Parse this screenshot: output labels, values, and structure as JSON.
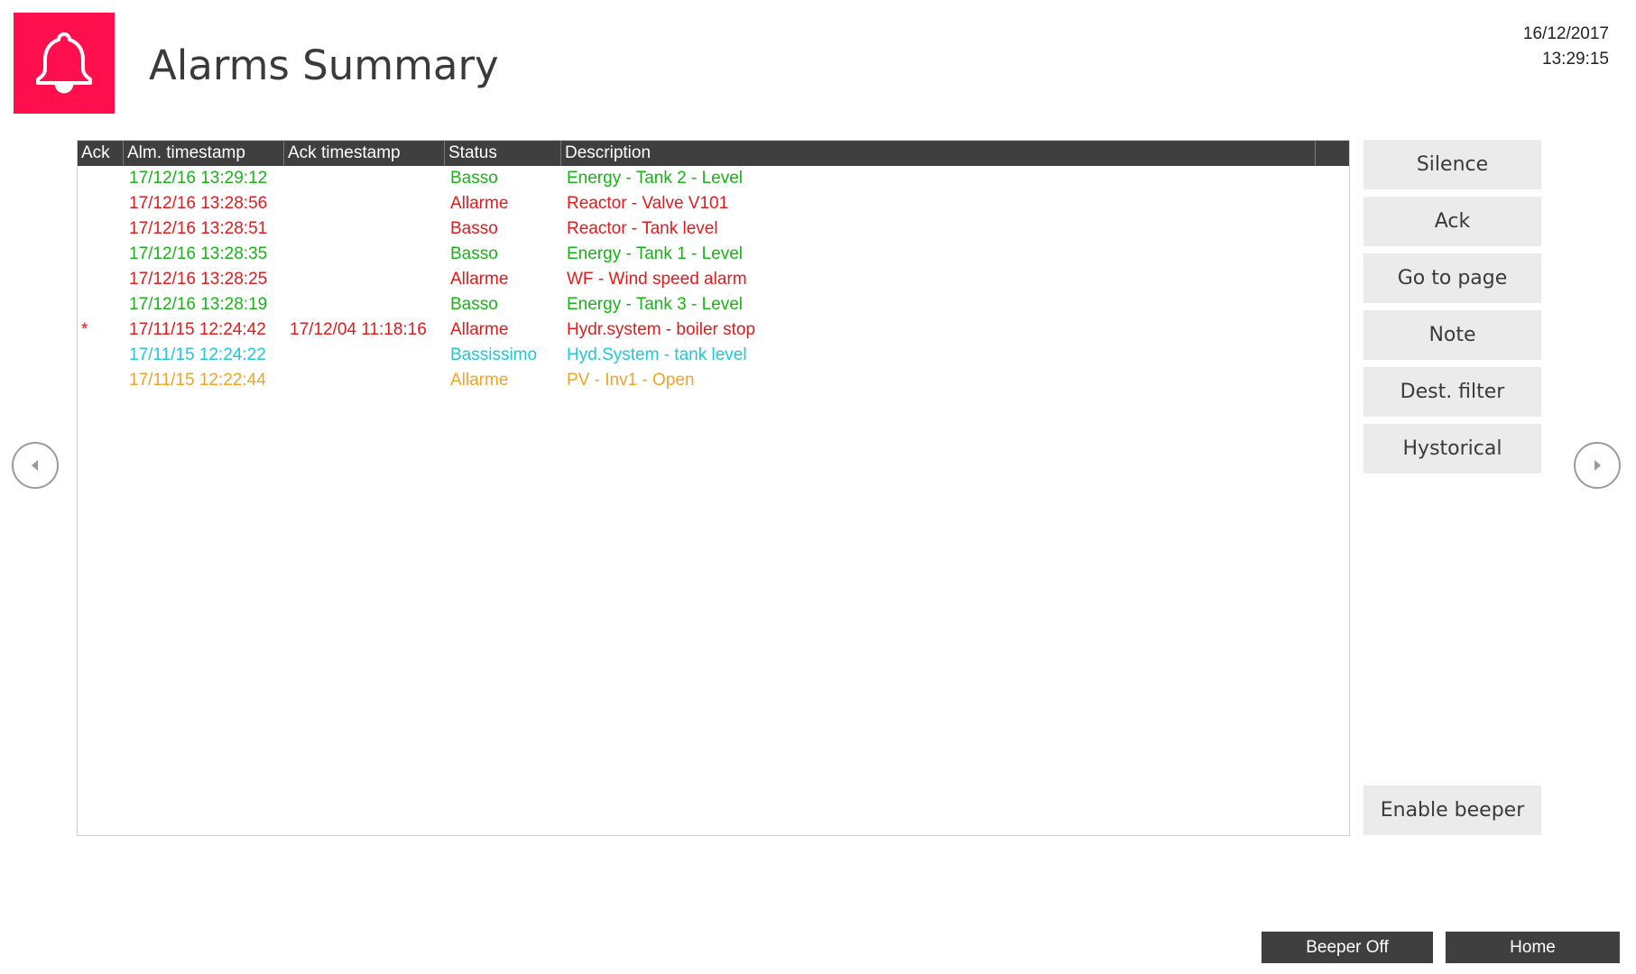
{
  "header": {
    "title": "Alarms Summary",
    "logo_icon": "bell-icon",
    "logo_color": "#ff0f4d",
    "date": "16/12/2017",
    "time": "13:29:15"
  },
  "table": {
    "columns": [
      "Ack",
      "Alm. timestamp",
      "Ack timestamp",
      "Status",
      "Description"
    ],
    "rows": [
      {
        "ack": "",
        "alm_ts": "17/12/16 13:29:12",
        "ack_ts": "",
        "status": "Basso",
        "description": "Energy - Tank 2 - Level",
        "color": "#19b319"
      },
      {
        "ack": "",
        "alm_ts": "17/12/16 13:28:56",
        "ack_ts": "",
        "status": "Allarme",
        "description": "Reactor - Valve V101",
        "color": "#e01b1b"
      },
      {
        "ack": "",
        "alm_ts": "17/12/16 13:28:51",
        "ack_ts": "",
        "status": "Basso",
        "description": "Reactor - Tank level",
        "color": "#e01b1b"
      },
      {
        "ack": "",
        "alm_ts": "17/12/16 13:28:35",
        "ack_ts": "",
        "status": "Basso",
        "description": "Energy - Tank 1 - Level",
        "color": "#19b319"
      },
      {
        "ack": "",
        "alm_ts": "17/12/16 13:28:25",
        "ack_ts": "",
        "status": "Allarme",
        "description": "WF - Wind speed alarm",
        "color": "#e01b1b"
      },
      {
        "ack": "",
        "alm_ts": "17/12/16 13:28:19",
        "ack_ts": "",
        "status": "Basso",
        "description": "Energy - Tank 3 - Level",
        "color": "#19b319"
      },
      {
        "ack": "*",
        "alm_ts": "17/11/15 12:24:42",
        "ack_ts": "17/12/04 11:18:16",
        "status": "Allarme",
        "description": "Hydr.system - boiler stop",
        "color": "#e01b1b"
      },
      {
        "ack": "",
        "alm_ts": "17/11/15 12:24:22",
        "ack_ts": "",
        "status": "Bassissimo",
        "description": "Hyd.System - tank level",
        "color": "#1fc8d6"
      },
      {
        "ack": "",
        "alm_ts": "17/11/15 12:22:44",
        "ack_ts": "",
        "status": "Allarme",
        "description": "PV - Inv1 - Open",
        "color": "#f0a326"
      }
    ]
  },
  "side_buttons": {
    "silence": "Silence",
    "ack": "Ack",
    "go_to_page": "Go to page",
    "note": "Note",
    "dest_filter": "Dest. filter",
    "hystorical": "Hystorical",
    "enable_beeper": "Enable beeper"
  },
  "navigation": {
    "prev_icon": "chevron-left-icon",
    "next_icon": "chevron-right-icon"
  },
  "footer": {
    "beeper_off": "Beeper Off",
    "home": "Home"
  }
}
